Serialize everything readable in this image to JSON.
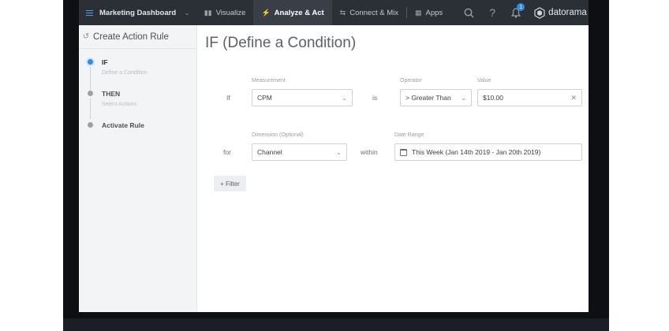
{
  "nav": {
    "dashboard_name": "Marketing Dashboard",
    "items": [
      {
        "label": "Visualize",
        "glyph": "bar-chart-icon"
      },
      {
        "label": "Analyze & Act",
        "glyph": "bolt-icon"
      },
      {
        "label": "Connect & Mix",
        "glyph": "plug-icon"
      },
      {
        "label": "Apps",
        "glyph": "grid-icon"
      }
    ],
    "notification_count": "1",
    "logo_text": "datorama"
  },
  "sidebar": {
    "title": "Create Action Rule",
    "steps": [
      {
        "title": "IF",
        "subtitle": "Define a Condition"
      },
      {
        "title": "THEN",
        "subtitle": "Select Actions"
      },
      {
        "title": "Activate Rule",
        "subtitle": ""
      }
    ]
  },
  "main": {
    "title": "IF (Define a Condition)",
    "row1": {
      "prefix": "If",
      "measurement_label": "Measurement",
      "measurement_value": "CPM",
      "connector": "is",
      "operator_label": "Operator",
      "operator_value": "> Greater Than",
      "value_label": "Value",
      "value_value": "$10.00"
    },
    "row2": {
      "prefix": "for",
      "dimension_label": "Dimension (Optional)",
      "dimension_value": "Channel",
      "connector": "within",
      "date_label": "Date Range",
      "date_value": "This Week (Jan 14th 2019 - Jan 20th 2019)"
    },
    "filter_button": "+ Filter"
  },
  "colors": {
    "nav_bg": "#2b2f36",
    "accent": "#2e8de8",
    "sidebar_bg": "#f3f4f6"
  }
}
